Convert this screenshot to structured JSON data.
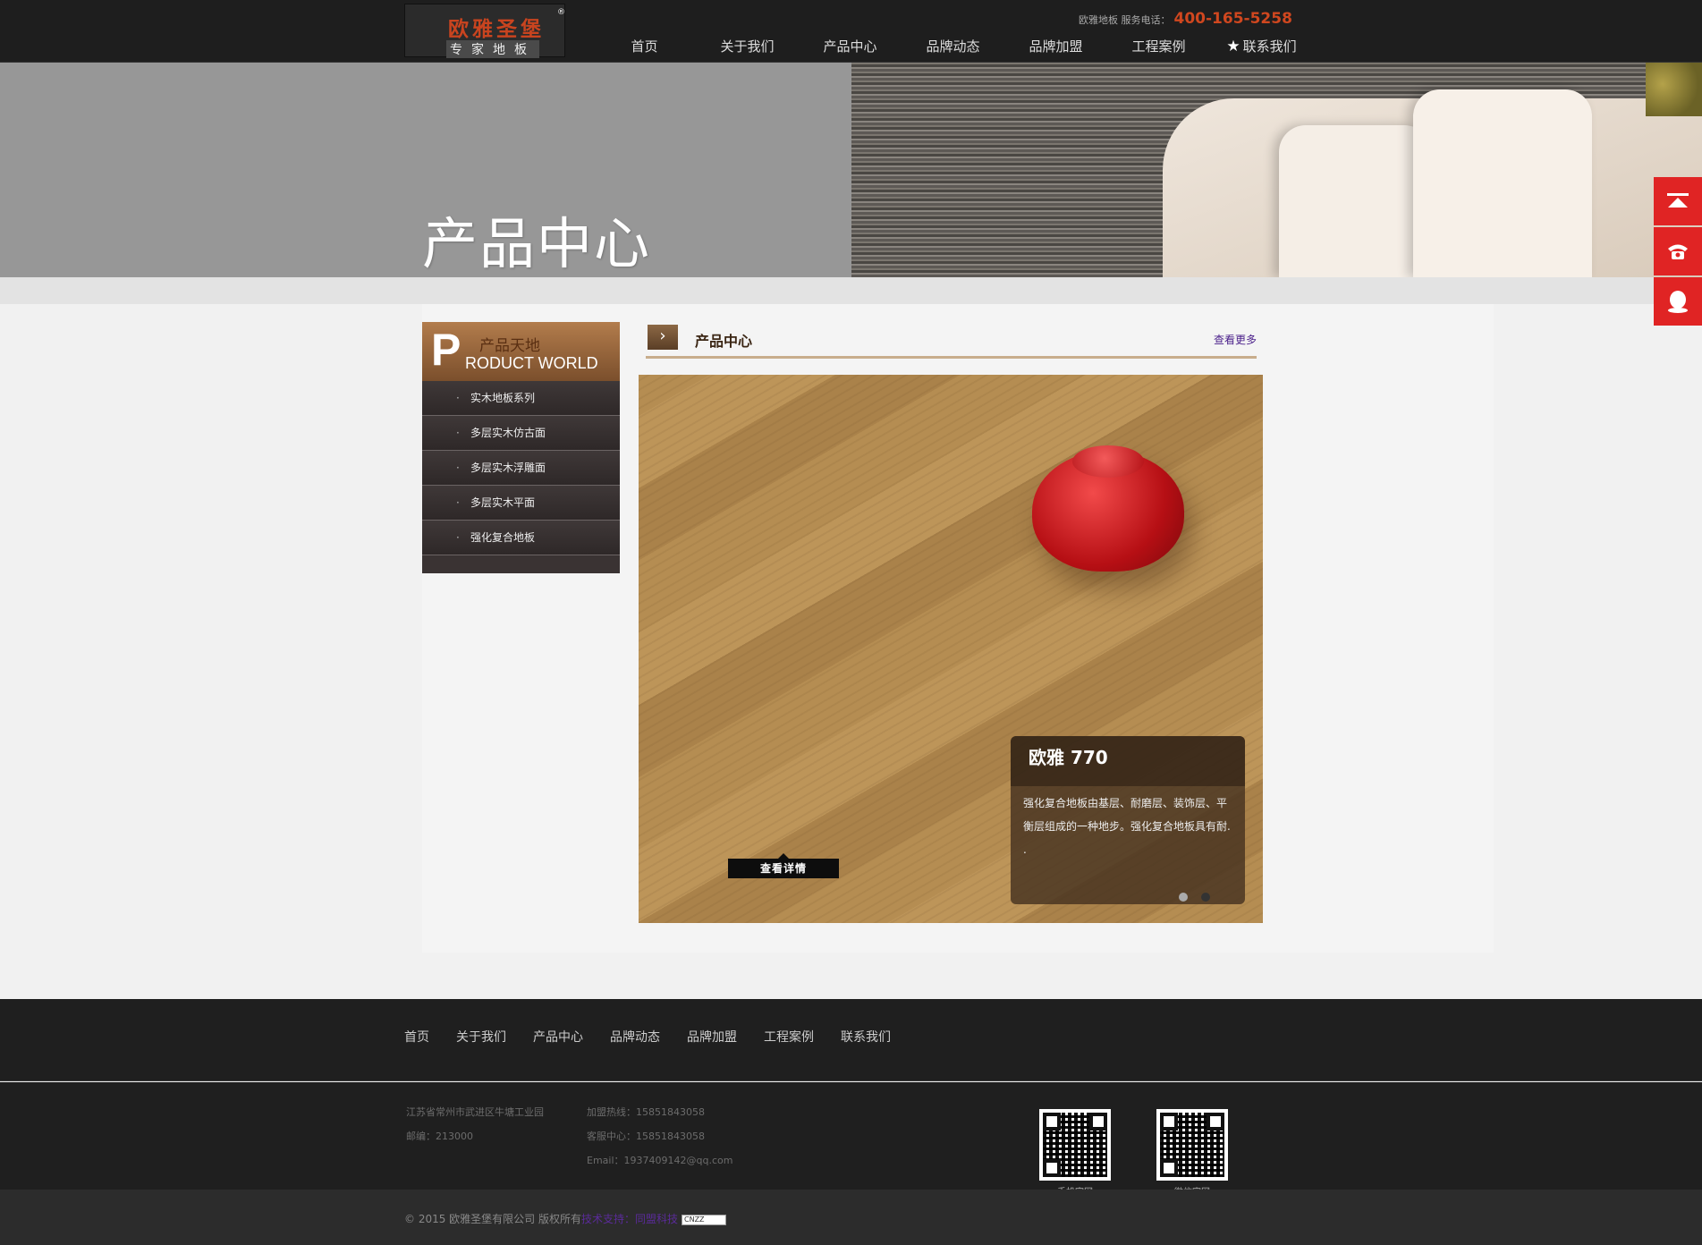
{
  "header": {
    "logo": {
      "main": "欧雅圣堡",
      "sub": "专家地板",
      "reg": "®"
    },
    "hotline_label": "欧雅地板 服务电话：",
    "hotline_number": "400-165-5258",
    "nav": [
      "首页",
      "关于我们",
      "产品中心",
      "品牌动态",
      "品牌加盟",
      "工程案例",
      "联系我们"
    ],
    "star_icon": "★"
  },
  "banner": {
    "title": "产品中心"
  },
  "side_tools": [
    "back-to-top-icon",
    "phone-icon",
    "qq-icon"
  ],
  "sidebar": {
    "head_letter": "P",
    "head_cn": "产品天地",
    "head_en": "RODUCT WORLD",
    "items": [
      "实木地板系列",
      "多层实木仿古面",
      "多层实木浮雕面",
      "多层实木平面",
      "强化复合地板"
    ]
  },
  "section": {
    "arrow": "›",
    "title": "产品中心",
    "more": "查看更多"
  },
  "product": {
    "name": "欧雅 770",
    "desc": "强化复合地板由基层、耐磨层、装饰层、平衡层组成的一种地步。强化复合地板具有耐. .",
    "detail_button": "查看详情",
    "slides": 2,
    "active_slide": 2
  },
  "footer": {
    "nav": [
      "首页",
      "关于我们",
      "产品中心",
      "品牌动态",
      "品牌加盟",
      "工程案例",
      "联系我们"
    ],
    "address": "江苏省常州市武进区牛塘工业园",
    "zip": "邮编：213000",
    "franchise": "加盟热线：15851843058",
    "service": "客服中心：15851843058",
    "email": "Email：1937409142@qq.com",
    "qr_mobile": "手机官网",
    "qr_wechat": "微信官网",
    "copyright": "© 2015 欧雅圣堡有限公司 版权所有",
    "tech_label": "技术支持：同盟科技",
    "cnzz": "CNZZ"
  }
}
